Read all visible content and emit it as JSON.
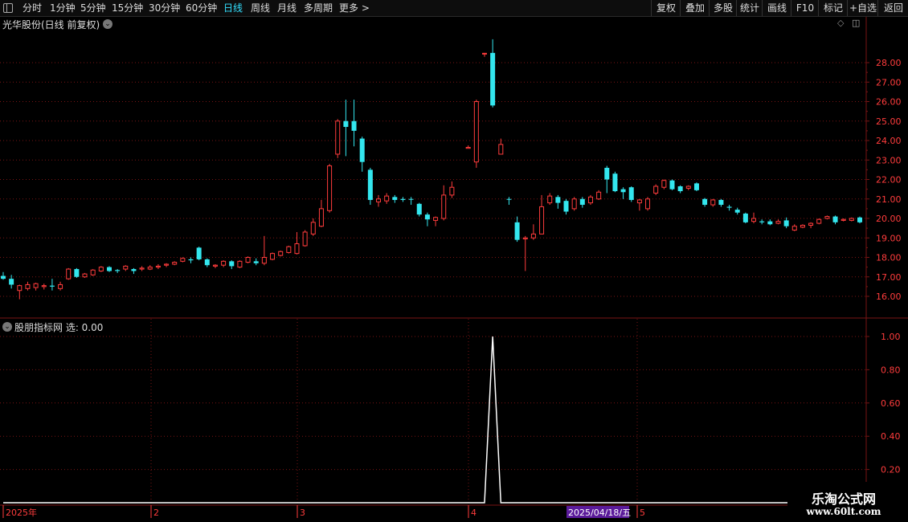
{
  "toolbar": {
    "periods": [
      "分时",
      "1分钟",
      "5分钟",
      "15分钟",
      "30分钟",
      "60分钟",
      "日线",
      "周线",
      "月线",
      "多周期",
      "更多 >"
    ],
    "active_period": "日线",
    "right_buttons": [
      "复权",
      "叠加",
      "多股",
      "统计",
      "画线",
      "F10",
      "标记",
      "+自选",
      "返回"
    ]
  },
  "main_panel": {
    "title": "光华股份(日线 前复权)",
    "price_axis": [
      "28.00",
      "27.00",
      "26.00",
      "25.00",
      "24.00",
      "23.00",
      "22.00",
      "21.00",
      "20.00",
      "19.00",
      "18.00",
      "17.00",
      "16.00"
    ]
  },
  "indicator_panel": {
    "title": "股朋指标网 选: 0.00",
    "axis": [
      "1.00",
      "0.80",
      "0.60",
      "0.40",
      "0.20"
    ]
  },
  "date_axis": {
    "labels": [
      "2025年",
      "2",
      "3",
      "4",
      "5"
    ],
    "cursor_date": "2025/04/18/五"
  },
  "logo": {
    "line1": "乐淘公式网",
    "line2": "www.60lt.com"
  },
  "colors": {
    "up": "#ff3c3c",
    "down": "#33e6ee",
    "grid": "#7a1414",
    "accent": "#33e0ff",
    "cursor_bg": "#5a1a9a"
  },
  "chart_data": {
    "type": "candlestick",
    "price_ylim": [
      15.0,
      29.2
    ],
    "indicator_ylim": [
      0,
      1.05
    ],
    "candles": [
      [
        17.05,
        16.9,
        17.25,
        16.85
      ],
      [
        16.9,
        16.6,
        17.1,
        16.4
      ],
      [
        16.3,
        16.55,
        16.6,
        15.85
      ],
      [
        16.4,
        16.6,
        16.75,
        16.3
      ],
      [
        16.45,
        16.65,
        16.7,
        16.3
      ],
      [
        16.5,
        16.55,
        16.65,
        16.35
      ],
      [
        16.55,
        16.5,
        16.9,
        16.3
      ],
      [
        16.4,
        16.6,
        16.75,
        16.3
      ],
      [
        16.9,
        17.4,
        17.45,
        16.85
      ],
      [
        17.4,
        17.0,
        17.45,
        16.95
      ],
      [
        17.0,
        17.15,
        17.2,
        16.95
      ],
      [
        17.1,
        17.35,
        17.4,
        17.05
      ],
      [
        17.3,
        17.5,
        17.55,
        17.25
      ],
      [
        17.5,
        17.3,
        17.55,
        17.25
      ],
      [
        17.35,
        17.3,
        17.4,
        17.2
      ],
      [
        17.4,
        17.55,
        17.6,
        17.3
      ],
      [
        17.4,
        17.3,
        17.45,
        17.15
      ],
      [
        17.4,
        17.45,
        17.55,
        17.3
      ],
      [
        17.4,
        17.5,
        17.6,
        17.35
      ],
      [
        17.5,
        17.55,
        17.65,
        17.4
      ],
      [
        17.6,
        17.65,
        17.7,
        17.5
      ],
      [
        17.65,
        17.75,
        17.8,
        17.6
      ],
      [
        17.8,
        17.95,
        18.0,
        17.75
      ],
      [
        17.9,
        17.85,
        18.0,
        17.7
      ],
      [
        18.5,
        17.9,
        18.55,
        17.85
      ],
      [
        17.9,
        17.6,
        17.95,
        17.5
      ],
      [
        17.55,
        17.6,
        17.65,
        17.45
      ],
      [
        17.6,
        17.8,
        17.85,
        17.5
      ],
      [
        17.8,
        17.55,
        17.85,
        17.4
      ],
      [
        17.5,
        17.8,
        17.85,
        17.45
      ],
      [
        17.75,
        18.0,
        18.05,
        17.7
      ],
      [
        17.8,
        17.7,
        17.95,
        17.6
      ],
      [
        17.7,
        18.0,
        19.1,
        17.6
      ],
      [
        17.9,
        18.2,
        18.25,
        17.85
      ],
      [
        18.1,
        18.3,
        18.35,
        18.05
      ],
      [
        18.25,
        18.55,
        18.6,
        18.2
      ],
      [
        18.2,
        18.7,
        19.3,
        18.15
      ],
      [
        18.6,
        19.3,
        19.4,
        18.55
      ],
      [
        19.2,
        19.8,
        20.0,
        19.1
      ],
      [
        19.6,
        20.5,
        20.95,
        19.55
      ],
      [
        20.4,
        22.7,
        22.8,
        20.3
      ],
      [
        23.3,
        25.0,
        25.1,
        23.1
      ],
      [
        25.0,
        24.7,
        26.1,
        23.2
      ],
      [
        25.0,
        24.5,
        26.1,
        23.7
      ],
      [
        24.1,
        22.9,
        24.2,
        22.4
      ],
      [
        22.5,
        20.95,
        22.6,
        20.7
      ],
      [
        20.85,
        21.0,
        21.2,
        20.6
      ],
      [
        20.9,
        21.15,
        21.3,
        20.75
      ],
      [
        21.1,
        20.95,
        21.2,
        20.8
      ],
      [
        21.0,
        20.95,
        21.1,
        20.85
      ],
      [
        21.0,
        20.98,
        21.1,
        20.7
      ],
      [
        20.75,
        20.2,
        20.8,
        20.1
      ],
      [
        20.2,
        19.95,
        20.3,
        19.6
      ],
      [
        19.9,
        20.05,
        20.1,
        19.6
      ],
      [
        20.0,
        21.2,
        21.7,
        19.9
      ],
      [
        21.2,
        21.6,
        21.9,
        21.05
      ],
      null,
      [
        23.6,
        23.65,
        23.75,
        23.6
      ],
      [
        22.9,
        26.0,
        26.1,
        22.6
      ],
      [
        28.45,
        28.48,
        28.5,
        28.3
      ],
      [
        28.5,
        25.8,
        29.2,
        25.7
      ],
      [
        23.3,
        23.8,
        24.1,
        23.3
      ],
      [
        21.0,
        20.98,
        21.1,
        20.7
      ],
      [
        19.8,
        18.9,
        20.1,
        18.8
      ],
      [
        18.95,
        19.0,
        19.1,
        17.3
      ],
      [
        19.0,
        19.2,
        19.7,
        18.9
      ],
      [
        19.2,
        20.6,
        21.2,
        19.2
      ],
      [
        20.8,
        21.15,
        21.3,
        20.7
      ],
      [
        21.1,
        20.8,
        21.2,
        20.5
      ],
      [
        20.9,
        20.35,
        21.0,
        20.2
      ],
      [
        20.5,
        21.0,
        21.1,
        20.4
      ],
      [
        21.0,
        20.7,
        21.1,
        20.55
      ],
      [
        20.8,
        21.1,
        21.2,
        20.7
      ],
      [
        21.0,
        21.35,
        21.45,
        20.95
      ],
      [
        22.6,
        22.0,
        22.7,
        21.3
      ],
      [
        22.3,
        21.4,
        22.4,
        21.35
      ],
      [
        21.5,
        21.35,
        21.6,
        21.0
      ],
      [
        21.6,
        20.95,
        21.65,
        20.85
      ],
      [
        20.8,
        20.95,
        21.0,
        20.4
      ],
      [
        20.5,
        21.0,
        21.1,
        20.4
      ],
      [
        21.3,
        21.65,
        21.75,
        21.2
      ],
      [
        21.6,
        21.95,
        22.0,
        21.5
      ],
      [
        21.95,
        21.5,
        22.0,
        21.45
      ],
      [
        21.65,
        21.4,
        21.7,
        21.3
      ],
      [
        21.55,
        21.65,
        21.7,
        21.45
      ],
      [
        21.8,
        21.45,
        21.85,
        21.4
      ],
      [
        21.0,
        20.7,
        21.05,
        20.6
      ],
      [
        20.7,
        20.95,
        21.0,
        20.6
      ],
      [
        20.95,
        20.7,
        21.0,
        20.6
      ],
      [
        20.6,
        20.55,
        20.7,
        20.4
      ],
      [
        20.45,
        20.3,
        20.55,
        20.2
      ],
      [
        20.25,
        19.8,
        20.3,
        19.75
      ],
      [
        19.85,
        20.0,
        20.3,
        19.75
      ],
      [
        19.85,
        19.8,
        19.95,
        19.7
      ],
      [
        19.85,
        19.7,
        19.95,
        19.65
      ],
      [
        19.75,
        19.85,
        19.95,
        19.7
      ],
      [
        19.9,
        19.6,
        20.05,
        19.5
      ],
      [
        19.4,
        19.6,
        19.7,
        19.35
      ],
      [
        19.55,
        19.65,
        19.7,
        19.5
      ],
      [
        19.65,
        19.75,
        19.8,
        19.5
      ],
      [
        19.75,
        19.95,
        20.0,
        19.7
      ],
      [
        20.0,
        20.1,
        20.15,
        19.95
      ],
      [
        20.1,
        19.8,
        20.15,
        19.7
      ],
      [
        19.9,
        19.95,
        20.0,
        19.85
      ],
      [
        19.9,
        20.0,
        20.05,
        19.85
      ],
      [
        20.05,
        19.8,
        20.1,
        19.75
      ]
    ],
    "indicator_values": [
      0,
      0,
      0,
      0,
      0,
      0,
      0,
      0,
      0,
      0,
      0,
      0,
      0,
      0,
      0,
      0,
      0,
      0,
      0,
      0,
      0,
      0,
      0,
      0,
      0,
      0,
      0,
      0,
      0,
      0,
      0,
      0,
      0,
      0,
      0,
      0,
      0,
      0,
      0,
      0,
      0,
      0,
      0,
      0,
      0,
      0,
      0,
      0,
      0,
      0,
      0,
      0,
      0,
      0,
      0,
      0,
      0,
      0,
      0,
      0,
      1,
      0,
      0,
      0,
      0,
      0,
      0,
      0,
      0,
      0,
      0,
      0,
      0,
      0,
      0,
      0,
      0,
      0,
      0,
      0,
      0,
      0,
      0,
      0,
      0,
      0,
      0,
      0,
      0,
      0,
      0,
      0,
      0,
      0,
      0,
      0,
      0,
      0,
      0,
      0,
      0,
      0,
      0,
      0,
      0,
      0
    ]
  }
}
